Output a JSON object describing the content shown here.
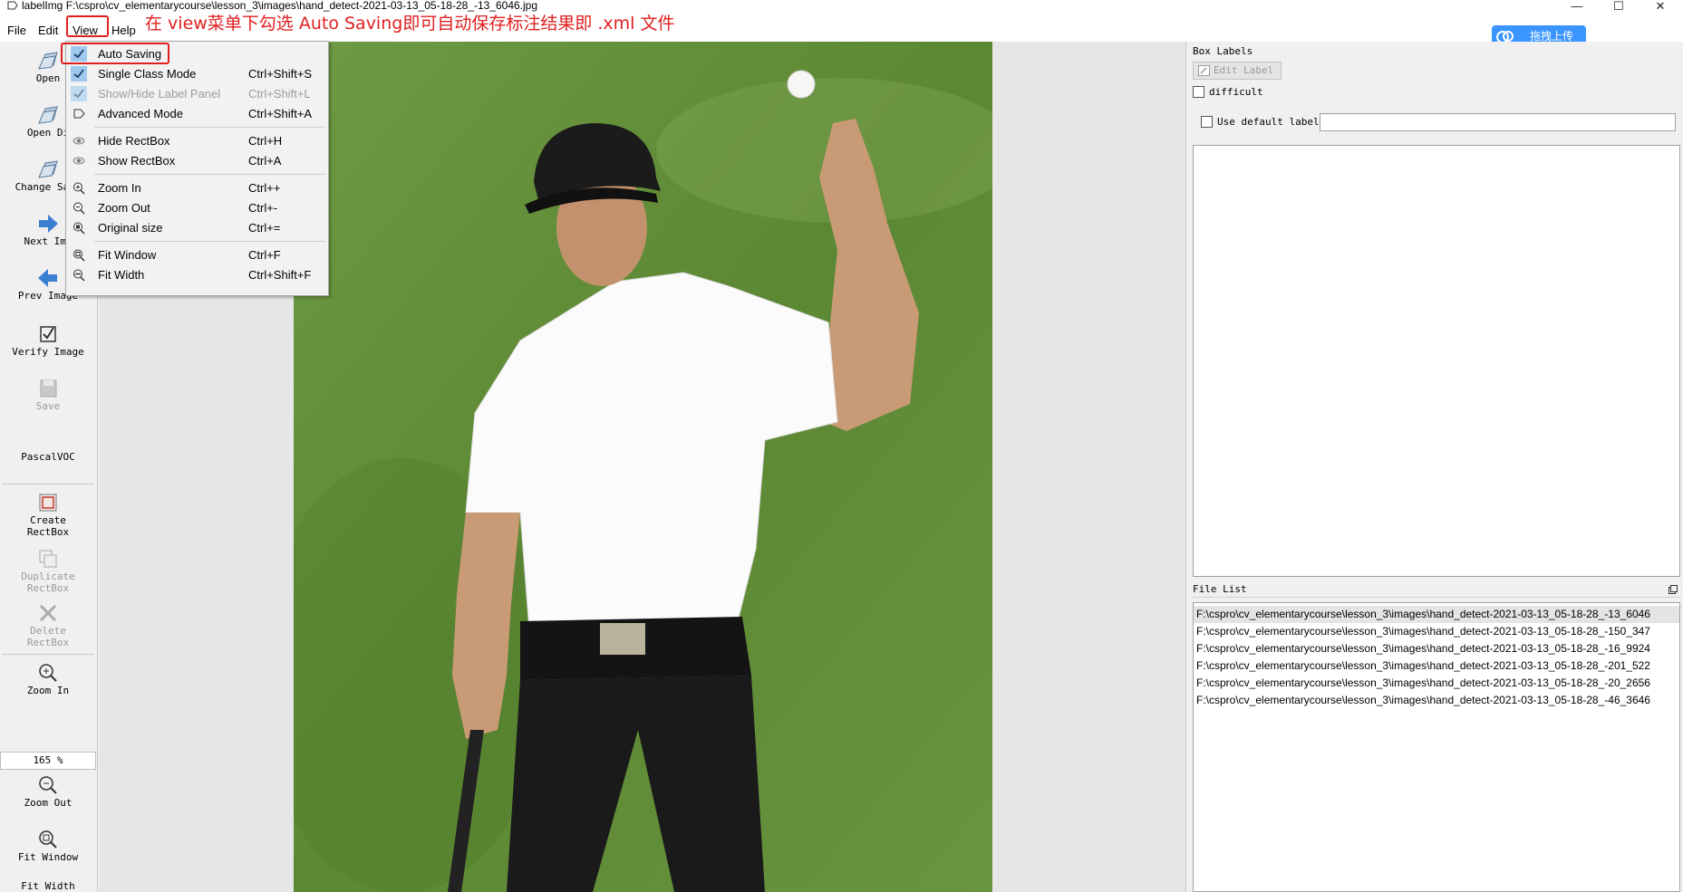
{
  "window": {
    "title": "labelImg F:\\cspro\\cv_elementarycourse\\lesson_3\\images\\hand_detect-2021-03-13_05-18-28_-13_6046.jpg",
    "controls": {
      "minimize": "—",
      "maximize": "☐",
      "close": "✕"
    }
  },
  "menubar": {
    "file": "File",
    "edit": "Edit",
    "view": "View",
    "help": "Help"
  },
  "annotation": "在 view菜单下勾选 Auto Saving即可自动保存标注结果即 .xml 文件",
  "upload": {
    "label": "拖拽上传"
  },
  "toolbar": {
    "open": "Open",
    "open_dir": "Open Di",
    "change_save": "Change Save",
    "next_image": "Next Ima",
    "prev_image": "Prev Image",
    "verify_image": "Verify Image",
    "save": "Save",
    "format": "PascalVOC",
    "create_rectbox": [
      "Create",
      "RectBox"
    ],
    "duplicate_rectbox": [
      "Duplicate",
      "RectBox"
    ],
    "delete_rectbox": [
      "Delete",
      "RectBox"
    ],
    "zoom_in": "Zoom In",
    "zoom_value": "165 %",
    "zoom_out": "Zoom Out",
    "fit_window": "Fit Window",
    "fit_width": "Fit Width"
  },
  "view_menu": [
    {
      "label": "Auto Saving",
      "shortcut": "",
      "checked": true,
      "enabled": true,
      "icon": "check-icon"
    },
    {
      "label": "Single Class Mode",
      "shortcut": "Ctrl+Shift+S",
      "checked": true,
      "enabled": true,
      "icon": "check-icon"
    },
    {
      "label": "Show/Hide Label Panel",
      "shortcut": "Ctrl+Shift+L",
      "checked": true,
      "enabled": false,
      "icon": "check-icon"
    },
    {
      "label": "Advanced Mode",
      "shortcut": "Ctrl+Shift+A",
      "checked": false,
      "enabled": true,
      "icon": "expert-icon"
    },
    {
      "label": "Hide RectBox",
      "shortcut": "Ctrl+H",
      "checked": false,
      "enabled": true,
      "icon": "eye-icon"
    },
    {
      "label": "Show RectBox",
      "shortcut": "Ctrl+A",
      "checked": false,
      "enabled": true,
      "icon": "eye-icon"
    },
    {
      "label": "Zoom In",
      "shortcut": "Ctrl++",
      "checked": false,
      "enabled": true,
      "icon": "zoom-in-icon"
    },
    {
      "label": "Zoom Out",
      "shortcut": "Ctrl+-",
      "checked": false,
      "enabled": true,
      "icon": "zoom-out-icon"
    },
    {
      "label": "Original size",
      "shortcut": "Ctrl+=",
      "checked": false,
      "enabled": true,
      "icon": "zoom-original-icon"
    },
    {
      "label": "Fit Window",
      "shortcut": "Ctrl+F",
      "checked": false,
      "enabled": true,
      "icon": "fit-window-icon"
    },
    {
      "label": "Fit Width",
      "shortcut": "Ctrl+Shift+F",
      "checked": false,
      "enabled": true,
      "icon": "fit-width-icon"
    }
  ],
  "dock": {
    "box_labels_title": "Box Labels",
    "edit_label": "Edit Label",
    "difficult": "difficult",
    "use_default_label": "Use default label",
    "default_label_value": "",
    "file_list_title": "File List",
    "files": [
      "F:\\cspro\\cv_elementarycourse\\lesson_3\\images\\hand_detect-2021-03-13_05-18-28_-13_6046",
      "F:\\cspro\\cv_elementarycourse\\lesson_3\\images\\hand_detect-2021-03-13_05-18-28_-150_347",
      "F:\\cspro\\cv_elementarycourse\\lesson_3\\images\\hand_detect-2021-03-13_05-18-28_-16_9924",
      "F:\\cspro\\cv_elementarycourse\\lesson_3\\images\\hand_detect-2021-03-13_05-18-28_-201_522",
      "F:\\cspro\\cv_elementarycourse\\lesson_3\\images\\hand_detect-2021-03-13_05-18-28_-20_2656",
      "F:\\cspro\\cv_elementarycourse\\lesson_3\\images\\hand_detect-2021-03-13_05-18-28_-46_3646"
    ]
  },
  "colors": {
    "annotation_red": "#e02020",
    "menu_check_bg": "#9fc9ee",
    "upload_blue": "#3a95ff",
    "grass_green": "#5f8a35"
  }
}
